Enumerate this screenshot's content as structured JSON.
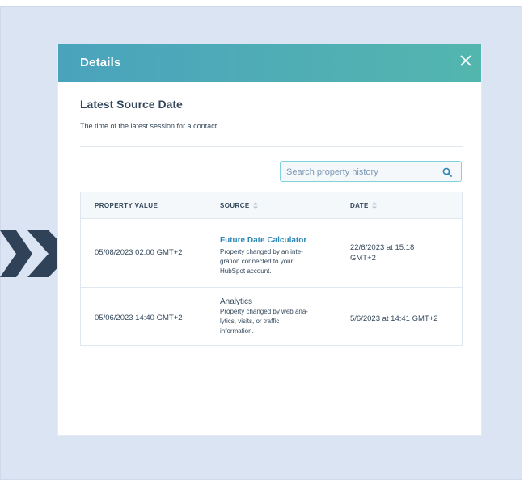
{
  "modal": {
    "title": "Details",
    "section_title": "Latest Source Date",
    "section_desc": "The time of the latest session for a contact",
    "search_placeholder": "Search property history"
  },
  "table": {
    "headers": {
      "property_value": "PROPERTY VALUE",
      "source": "SOURCE",
      "date": "DATE"
    },
    "rows": [
      {
        "value": "05/08/2023 02:00 GMT+2",
        "source_name": "Future Date Calculator",
        "source_desc_lines": [
          "Property changed by an inte-",
          "gration connected to your",
          "HubSpot account."
        ],
        "date_lines": [
          "22/6/2023 at 15:18",
          "GMT+2"
        ]
      },
      {
        "value": "05/06/2023 14:40 GMT+2",
        "source_name": "Analytics",
        "source_desc_lines": [
          "Property changed by web ana-",
          "lytics, visits, or traffic",
          "information."
        ],
        "date_lines": [
          "5/6/2023 at 14:41 GMT+2"
        ]
      }
    ]
  },
  "colors": {
    "header_gradient_start": "#4aa3bd",
    "header_gradient_end": "#53b6ae",
    "link": "#2e86b7",
    "chevron": "#2f4257",
    "backdrop": "#dbe4f2"
  },
  "icons": {
    "close": "close-icon",
    "search": "search-icon",
    "sort": "sort-icon",
    "chevrons": "double-chevron-right-icon"
  }
}
